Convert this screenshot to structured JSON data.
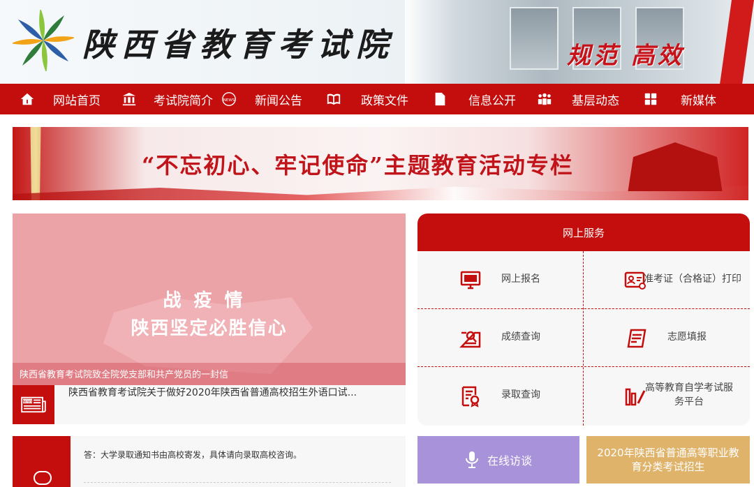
{
  "header": {
    "site_title": "陕西省教育考试院",
    "slogan": "规范 高效",
    "logo_colors": [
      "#2f7d3a",
      "#f2a317",
      "#2d5fa8",
      "#8cc63e"
    ]
  },
  "nav": {
    "items": [
      {
        "label": "网站首页",
        "icon": "home-icon"
      },
      {
        "label": "考试院简介",
        "icon": "institution-icon"
      },
      {
        "label": "新闻公告",
        "icon": "news-icon"
      },
      {
        "label": "政策文件",
        "icon": "book-icon"
      },
      {
        "label": "信息公开",
        "icon": "document-icon"
      },
      {
        "label": "基层动态",
        "icon": "people-icon"
      },
      {
        "label": "新媒体",
        "icon": "grid-icon"
      }
    ]
  },
  "banner": {
    "text": "“不忘初心、牢记使命”主题教育活动专栏"
  },
  "slider": {
    "line1": "战疫情",
    "line2": "陕西坚定必胜信心",
    "caption": "陕西省教育考试院致全院党支部和共产党员的一封信"
  },
  "news": {
    "headline": "陕西省教育考试院关于做好2020年陕西省普通高校招生外语口试..."
  },
  "service": {
    "title": "网上服务",
    "items": [
      {
        "label": "网上报名",
        "icon": "monitor-icon"
      },
      {
        "label": "准考证（合格证）打印",
        "icon": "ticket-icon"
      },
      {
        "label": "成绩查询",
        "icon": "score-icon"
      },
      {
        "label": "志愿填报",
        "icon": "pen-icon"
      },
      {
        "label": "录取查询",
        "icon": "admission-icon"
      },
      {
        "label": "高等教育自学考试服务平台",
        "icon": "chart-icon"
      }
    ]
  },
  "qa": {
    "text": "答：大学录取通知书由高校寄发，具体请向录取高校咨询。"
  },
  "buttons": {
    "interview": "在线访谈",
    "recruit": "2020年陕西省普通高等职业教育分类考试招生"
  },
  "colors": {
    "primary_red": "#c40d0d",
    "interview_purple": "#a892d9",
    "recruit_gold": "#e0b36b"
  }
}
